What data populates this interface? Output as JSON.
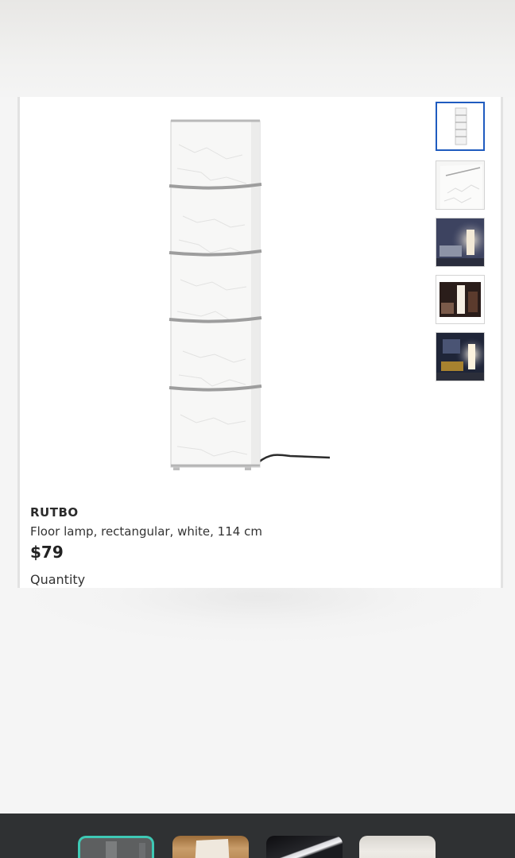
{
  "product": {
    "name": "RUTBO",
    "description": "Floor lamp, rectangular, white, 114 cm",
    "price": "$79",
    "quantity_label": "Quantity"
  },
  "gallery": {
    "selected_index": 0,
    "thumbnails": [
      {
        "icon": "lamp-product-thumbnail"
      },
      {
        "icon": "lamp-detail-thumbnail"
      },
      {
        "icon": "living-room-thumbnail"
      },
      {
        "icon": "lamp-in-room-thumbnail"
      },
      {
        "icon": "lamp-in-living-room-thumbnail"
      }
    ]
  },
  "bottom_bar": {
    "thumbnails": [
      {
        "icon": "photo-thumbnail-1",
        "selected": true
      },
      {
        "icon": "photo-thumbnail-2"
      },
      {
        "icon": "photo-thumbnail-3"
      },
      {
        "icon": "photo-thumbnail-4"
      }
    ]
  },
  "colors": {
    "selected_border": "#1f5bbf",
    "bottom_bar_bg": "#2f3133",
    "bottom_selected_border": "#3ec9b5"
  }
}
